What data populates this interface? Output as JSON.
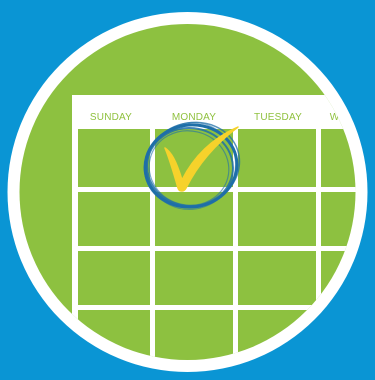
{
  "colors": {
    "background": "#0a95d4",
    "green": "#8dc140",
    "ring": "#ffffff",
    "grid": "#ffffff",
    "label": "#8fc13e",
    "check": "#f6d22b",
    "scribble": "#1f6fa8"
  },
  "calendar": {
    "days": [
      "SUNDAY",
      "MONDAY",
      "TUESDAY",
      "WE"
    ],
    "checked_day": "MONDAY"
  },
  "icons": {
    "check": "checkmark-icon",
    "circle": "scribble-circle-icon"
  }
}
